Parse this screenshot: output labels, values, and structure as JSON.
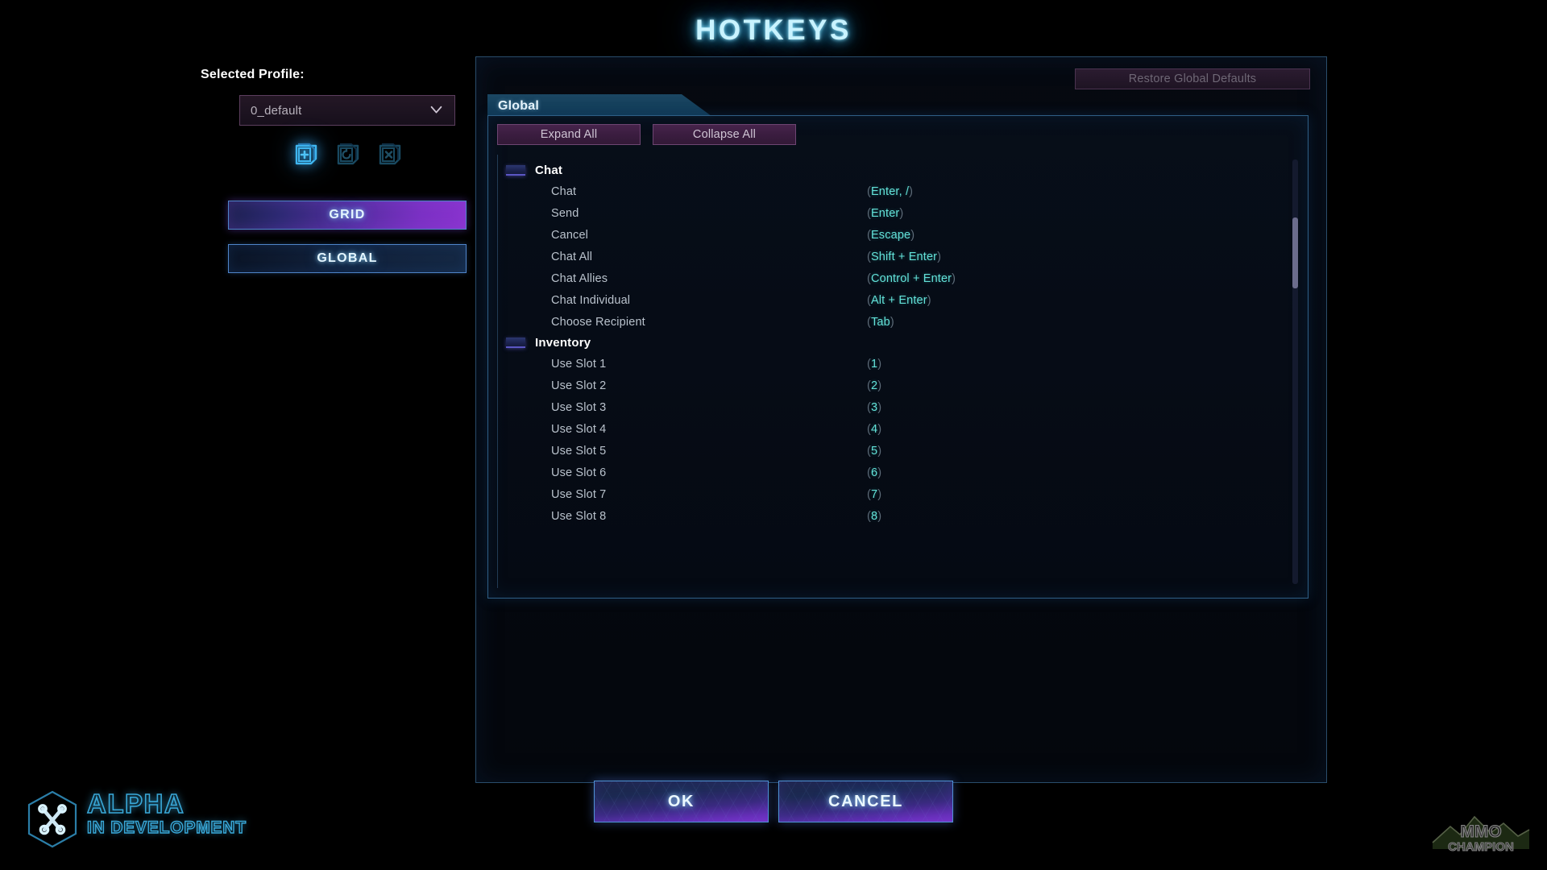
{
  "page": {
    "title": "HOTKEYS"
  },
  "sidebar": {
    "profile_label": "Selected Profile:",
    "profile_value": "0_default",
    "profile_chevron_icon": "chevron-down-icon",
    "icons": [
      {
        "name": "new-profile-icon",
        "title": "New Profile",
        "enabled": true
      },
      {
        "name": "reset-profile-icon",
        "title": "Reset Profile",
        "enabled": false
      },
      {
        "name": "delete-profile-icon",
        "title": "Delete Profile",
        "enabled": false
      }
    ],
    "nav": [
      {
        "label": "GRID",
        "selected": true
      },
      {
        "label": "GLOBAL",
        "selected": false
      }
    ]
  },
  "panel": {
    "restore_defaults_label": "Restore Global Defaults",
    "category_tab_label": "Global",
    "expand_all_label": "Expand All",
    "collapse_all_label": "Collapse All"
  },
  "hotkeys": {
    "groups": [
      {
        "name": "Chat",
        "expanded": true,
        "rows": [
          {
            "action": "Chat",
            "keys": "Enter, /"
          },
          {
            "action": "Send",
            "keys": "Enter"
          },
          {
            "action": "Cancel",
            "keys": "Escape"
          },
          {
            "action": "Chat All",
            "keys": "Shift + Enter"
          },
          {
            "action": "Chat Allies",
            "keys": "Control + Enter"
          },
          {
            "action": "Chat Individual",
            "keys": "Alt + Enter"
          },
          {
            "action": "Choose Recipient",
            "keys": "Tab"
          }
        ]
      },
      {
        "name": "Inventory",
        "expanded": true,
        "rows": [
          {
            "action": "Use Slot 1",
            "keys": "1"
          },
          {
            "action": "Use Slot 2",
            "keys": "2"
          },
          {
            "action": "Use Slot 3",
            "keys": "3"
          },
          {
            "action": "Use Slot 4",
            "keys": "4"
          },
          {
            "action": "Use Slot 5",
            "keys": "5"
          },
          {
            "action": "Use Slot 6",
            "keys": "6"
          },
          {
            "action": "Use Slot 7",
            "keys": "7"
          },
          {
            "action": "Use Slot 8",
            "keys": "8"
          }
        ]
      }
    ]
  },
  "footer": {
    "ok_label": "OK",
    "cancel_label": "CANCEL"
  },
  "branding": {
    "alpha_line1": "ALPHA",
    "alpha_line2": "IN DEVELOPMENT",
    "hex_icon": "crossed-wrenches-icon",
    "watermark": "mmo-champion-logo"
  },
  "colors": {
    "accent_cyan": "#63e2d9",
    "title_glow": "#c9f3ff",
    "selected_purple": "#7b31c4",
    "panel_border": "#2f5f86"
  }
}
